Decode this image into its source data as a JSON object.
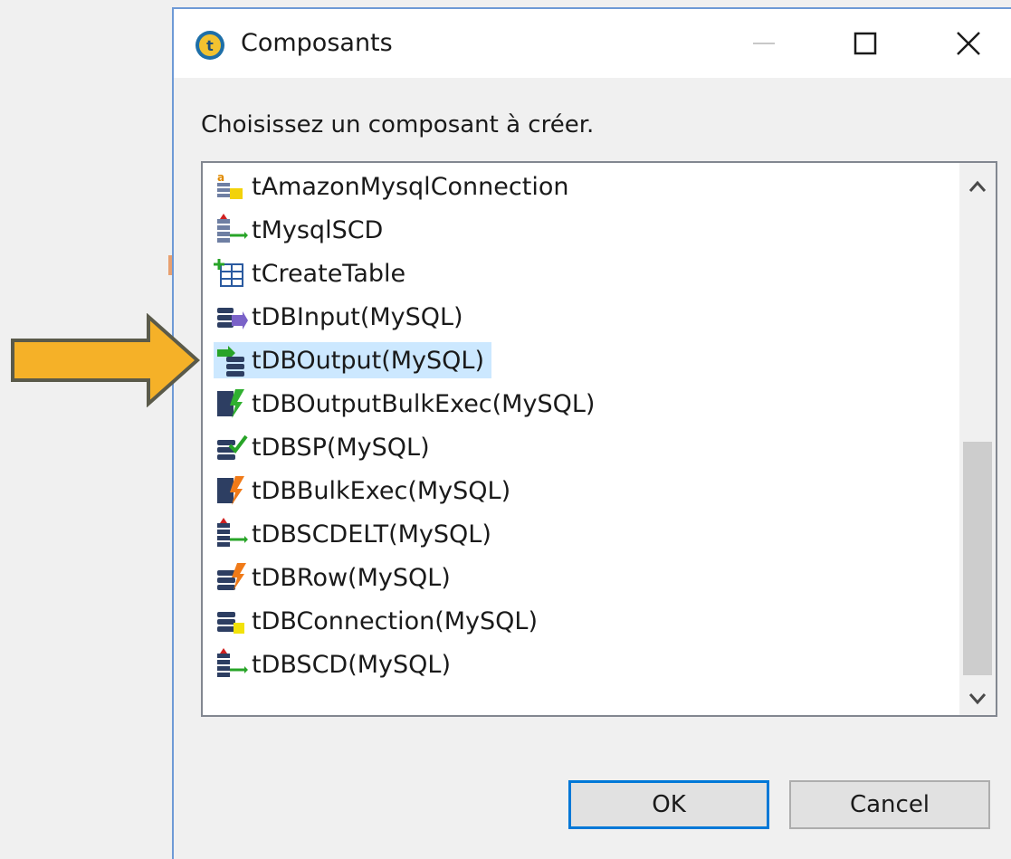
{
  "window": {
    "title": "Composants",
    "minimize_icon": "minimize-icon",
    "maximize_icon": "maximize-icon",
    "close_icon": "close-icon"
  },
  "prompt": "Choisissez un composant à créer.",
  "components": [
    {
      "label": "tAmazonMysqlConnection",
      "icon": "amazon-mysql-connection-icon"
    },
    {
      "label": "tMysqlSCD",
      "icon": "scd-icon"
    },
    {
      "label": "tCreateTable",
      "icon": "create-table-icon"
    },
    {
      "label": "tDBInput(MySQL)",
      "icon": "db-input-icon"
    },
    {
      "label": "tDBOutput(MySQL)",
      "icon": "db-output-icon",
      "selected": true
    },
    {
      "label": "tDBOutputBulkExec(MySQL)",
      "icon": "bulk-exec-icon"
    },
    {
      "label": "tDBSP(MySQL)",
      "icon": "db-sp-icon"
    },
    {
      "label": "tDBBulkExec(MySQL)",
      "icon": "bulk-exec-icon"
    },
    {
      "label": "tDBSCDELT(MySQL)",
      "icon": "scd-icon"
    },
    {
      "label": "tDBRow(MySQL)",
      "icon": "db-row-icon"
    },
    {
      "label": "tDBConnection(MySQL)",
      "icon": "db-connection-icon"
    },
    {
      "label": "tDBSCD(MySQL)",
      "icon": "scd-icon"
    }
  ],
  "buttons": {
    "ok": "OK",
    "cancel": "Cancel"
  },
  "colors": {
    "selection": "#cce8ff",
    "callout_arrow": "#f5b128",
    "callout_arrow_border": "#5a5a4a",
    "ok_border": "#0078d7"
  }
}
